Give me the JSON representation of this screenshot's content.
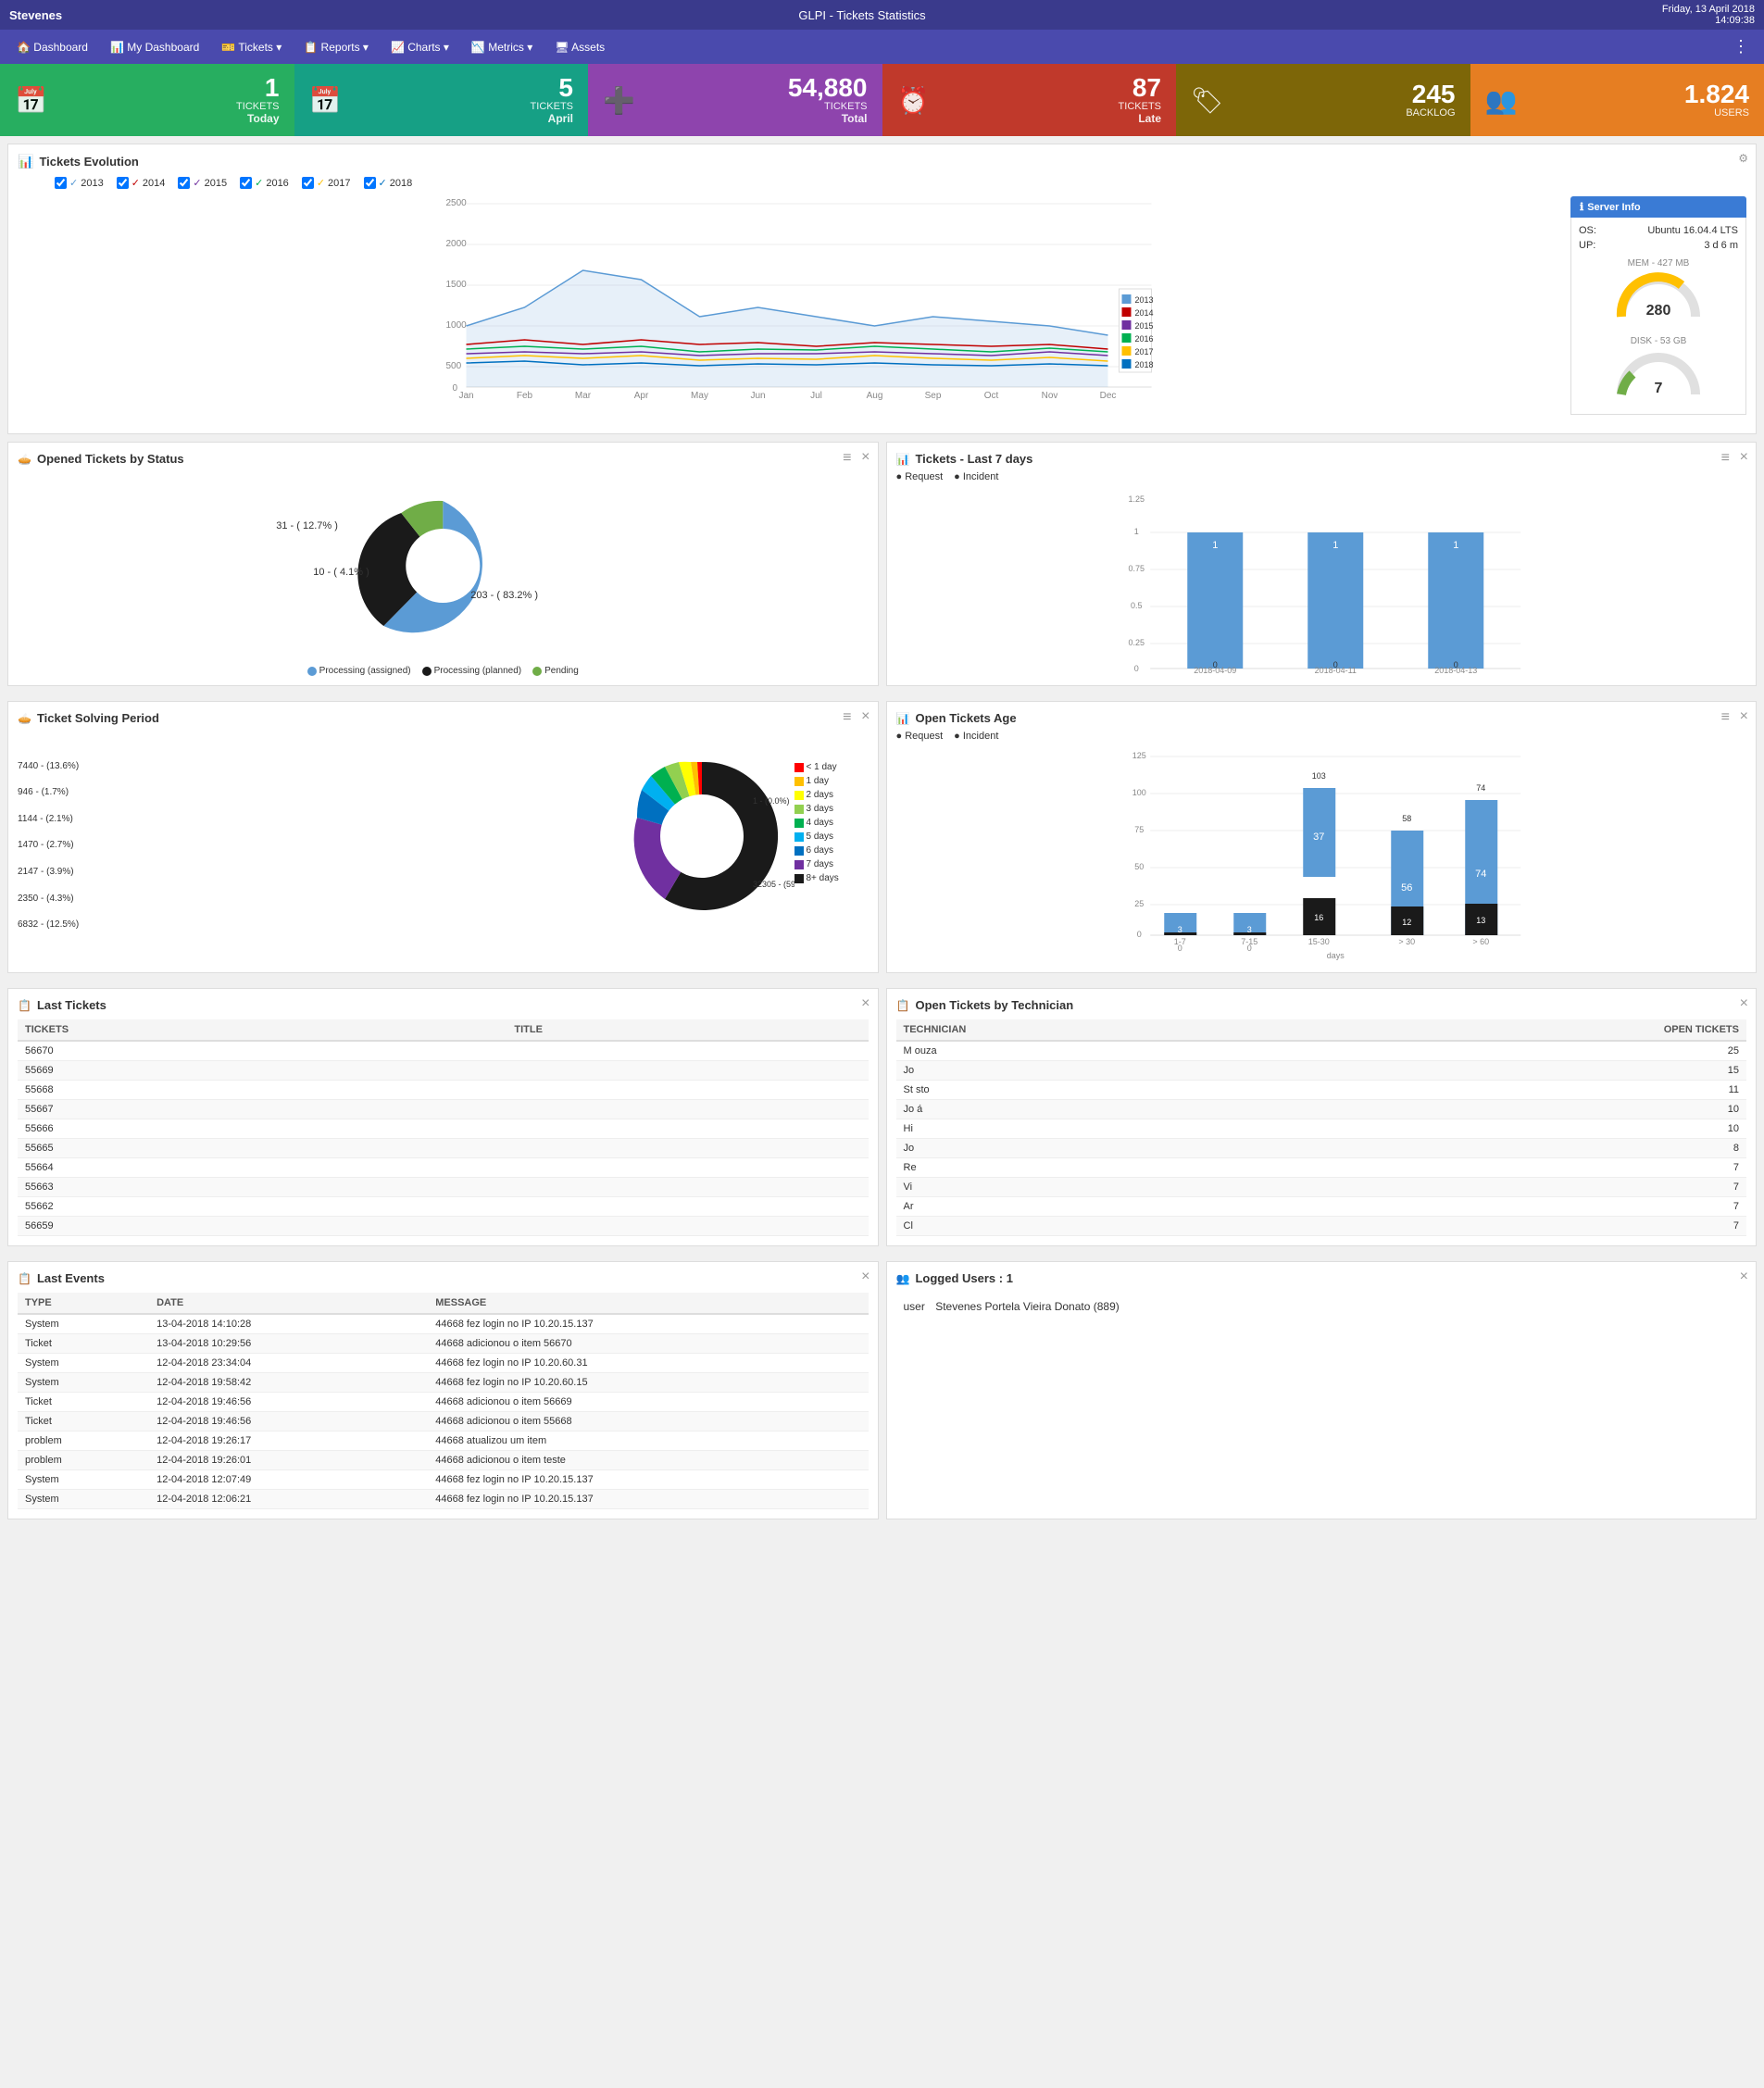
{
  "header": {
    "user": "Stevenes",
    "title": "GLPI - Tickets Statistics",
    "date": "Friday, 13 April 2018",
    "time": "14:09:38"
  },
  "nav": {
    "items": [
      {
        "label": "🏠 Dashboard",
        "icon": "dashboard-icon"
      },
      {
        "label": "📊 My Dashboard",
        "icon": "mydashboard-icon"
      },
      {
        "label": "🎫 Tickets ▾",
        "icon": "tickets-icon"
      },
      {
        "label": "📋 Reports ▾",
        "icon": "reports-icon"
      },
      {
        "label": "📈 Charts ▾",
        "icon": "charts-icon"
      },
      {
        "label": "📉 Metrics ▾",
        "icon": "metrics-icon"
      },
      {
        "label": "🖥 Assets",
        "icon": "assets-icon"
      }
    ]
  },
  "stats": [
    {
      "number": "1",
      "label": "TICKETS",
      "sublabel": "Today",
      "color": "green",
      "icon": "📅"
    },
    {
      "number": "5",
      "label": "TICKETS",
      "sublabel": "April",
      "color": "teal",
      "icon": "📅"
    },
    {
      "number": "54,880",
      "label": "TICKETS",
      "sublabel": "Total",
      "color": "purple",
      "icon": "➕"
    },
    {
      "number": "87",
      "label": "TICKETS",
      "sublabel": "Late",
      "color": "crimson",
      "icon": "⏰"
    },
    {
      "number": "245",
      "label": "BACKLOG",
      "sublabel": "",
      "color": "brown",
      "icon": "🏷"
    },
    {
      "number": "1.824",
      "label": "USERS",
      "sublabel": "",
      "color": "orange",
      "icon": "👥"
    }
  ],
  "evolution": {
    "title": "Tickets Evolution",
    "legend": [
      {
        "year": "2013",
        "color": "#5b9bd5"
      },
      {
        "year": "2014",
        "color": "#c00000"
      },
      {
        "year": "2015",
        "color": "#7030a0"
      },
      {
        "year": "2016",
        "color": "#00b050"
      },
      {
        "year": "2017",
        "color": "#ffc000"
      },
      {
        "year": "2018",
        "color": "#0070c0"
      }
    ],
    "checked": [
      "2013",
      "2014",
      "2015",
      "2016",
      "2017",
      "2018"
    ],
    "x_labels": [
      "Jan",
      "Feb",
      "Mar",
      "Apr",
      "May",
      "Jun",
      "Jul",
      "Aug",
      "Sep",
      "Oct",
      "Nov",
      "Dec"
    ],
    "y_max": 2500
  },
  "server_info": {
    "title": "Server Info",
    "os": "Ubuntu 16.04.4 LTS",
    "up": "3 d 6 m",
    "mem_label": "MEM - 427 MB",
    "mem_value": 280,
    "disk_label": "DISK - 53 GB",
    "disk_value": 7
  },
  "opened_by_status": {
    "title": "Opened Tickets by Status",
    "segments": [
      {
        "label": "Processing (assigned)",
        "value": 203,
        "pct": 83.2,
        "color": "#5b9bd5"
      },
      {
        "label": "Processing (planned)",
        "value": 10,
        "pct": 4.1,
        "color": "#1a1a1a"
      },
      {
        "label": "Pending",
        "value": 31,
        "pct": 12.7,
        "color": "#70ad47"
      }
    ]
  },
  "tickets_last7": {
    "title": "Tickets - Last 7 days",
    "legend": [
      "Request",
      "Incident"
    ],
    "bars": [
      {
        "date": "2018-04-09",
        "request": 1,
        "incident": 0
      },
      {
        "date": "2018-04-11",
        "request": 1,
        "incident": 0
      },
      {
        "date": "2018-04-13",
        "request": 1,
        "incident": 0
      }
    ],
    "y_max": 1.25
  },
  "solving_period": {
    "title": "Ticket Solving Period",
    "segments": [
      {
        "label": "< 1 day",
        "value": 1,
        "pct": 0.0,
        "color": "#ff0000"
      },
      {
        "label": "1 day",
        "value": 946,
        "pct": 1.7,
        "color": "#ffc000"
      },
      {
        "label": "2 days",
        "value": 1144,
        "pct": 2.1,
        "color": "#ffff00"
      },
      {
        "label": "3 days",
        "value": 1470,
        "pct": 2.7,
        "color": "#92d050"
      },
      {
        "label": "4 days",
        "value": 2147,
        "pct": 3.9,
        "color": "#00b050"
      },
      {
        "label": "5 days",
        "value": 2350,
        "pct": 4.3,
        "color": "#00b0f0"
      },
      {
        "label": "6 days",
        "value": 6832,
        "pct": 12.5,
        "color": "#0070c0"
      },
      {
        "label": "7 days",
        "value": 7440,
        "pct": 13.6,
        "color": "#7030a0"
      },
      {
        "label": "8+ days",
        "value": 32305,
        "pct": 59.1,
        "color": "#1a1a1a"
      }
    ]
  },
  "open_tickets_age": {
    "title": "Open Tickets Age",
    "legend": [
      "Request",
      "Incident"
    ],
    "groups": [
      {
        "label": "1-7",
        "sublabel": "days",
        "request": 3,
        "incident": 0
      },
      {
        "label": "7-15",
        "sublabel": "days",
        "request": 3,
        "incident": 0
      },
      {
        "label": "15-30",
        "sublabel": "days",
        "request": 37,
        "incident": 16,
        "total": 103
      },
      {
        "label": "> 30",
        "sublabel": "days",
        "request": 56,
        "incident": 12,
        "total": 58
      },
      {
        "label": "> 60",
        "sublabel": "days",
        "request": 74,
        "incident": 13,
        "total": 74
      }
    ],
    "y_max": 125
  },
  "last_tickets": {
    "title": "Last Tickets",
    "headers": [
      "TICKETS",
      "TITLE"
    ],
    "rows": [
      {
        "id": "56670",
        "title": ""
      },
      {
        "id": "55669",
        "title": ""
      },
      {
        "id": "55668",
        "title": ""
      },
      {
        "id": "55667",
        "title": ""
      },
      {
        "id": "55666",
        "title": ""
      },
      {
        "id": "55665",
        "title": ""
      },
      {
        "id": "55664",
        "title": ""
      },
      {
        "id": "55663",
        "title": ""
      },
      {
        "id": "55662",
        "title": ""
      },
      {
        "id": "56659",
        "title": ""
      }
    ]
  },
  "open_by_tech": {
    "title": "Open Tickets by Technician",
    "headers": [
      "TECHNICIAN",
      "OPEN TICKETS"
    ],
    "rows": [
      {
        "tech": "M      ouza",
        "tickets": 25
      },
      {
        "tech": "Jo",
        "tickets": 15
      },
      {
        "tech": "St      sto",
        "tickets": 11
      },
      {
        "tech": "Jo      á",
        "tickets": 10
      },
      {
        "tech": "Hi",
        "tickets": 10
      },
      {
        "tech": "Jo",
        "tickets": 8
      },
      {
        "tech": "Re",
        "tickets": 7
      },
      {
        "tech": "Vi",
        "tickets": 7
      },
      {
        "tech": "Ar",
        "tickets": 7
      },
      {
        "tech": "Cl",
        "tickets": 7
      }
    ]
  },
  "last_events": {
    "title": "Last Events",
    "headers": [
      "TYPE",
      "DATE",
      "MESSAGE"
    ],
    "rows": [
      {
        "type": "System",
        "date": "13-04-2018 14:10:28",
        "message": "44668 fez login no IP 10.20.15.137",
        "rowtype": "system"
      },
      {
        "type": "Ticket",
        "date": "13-04-2018 10:29:56",
        "message": "44668 adicionou o item 56670",
        "rowtype": "ticket"
      },
      {
        "type": "System",
        "date": "12-04-2018 23:34:04",
        "message": "44668 fez login no IP 10.20.60.31",
        "rowtype": "system"
      },
      {
        "type": "System",
        "date": "12-04-2018 19:58:42",
        "message": "44668 fez login no IP 10.20.60.15",
        "rowtype": "system"
      },
      {
        "type": "Ticket",
        "date": "12-04-2018 19:46:56",
        "message": "44668 adicionou o item 56669",
        "rowtype": "ticket"
      },
      {
        "type": "Ticket",
        "date": "12-04-2018 19:46:56",
        "message": "44668 adicionou o item 55668",
        "rowtype": "ticket"
      },
      {
        "type": "problem",
        "date": "12-04-2018 19:26:17",
        "message": "44668 atualizou um item",
        "rowtype": "problem"
      },
      {
        "type": "problem",
        "date": "12-04-2018 19:26:01",
        "message": "44668 adicionou o item teste",
        "rowtype": "problem"
      },
      {
        "type": "System",
        "date": "12-04-2018 12:07:49",
        "message": "44668 fez login no IP 10.20.15.137",
        "rowtype": "system"
      },
      {
        "type": "System",
        "date": "12-04-2018 12:06:21",
        "message": "44668 fez login no IP 10.20.15.137",
        "rowtype": "system"
      }
    ]
  },
  "logged_users": {
    "title": "Logged Users : 1",
    "users": [
      {
        "label": "user",
        "name": "Stevenes Portela Vieira Donato (889)"
      }
    ]
  }
}
